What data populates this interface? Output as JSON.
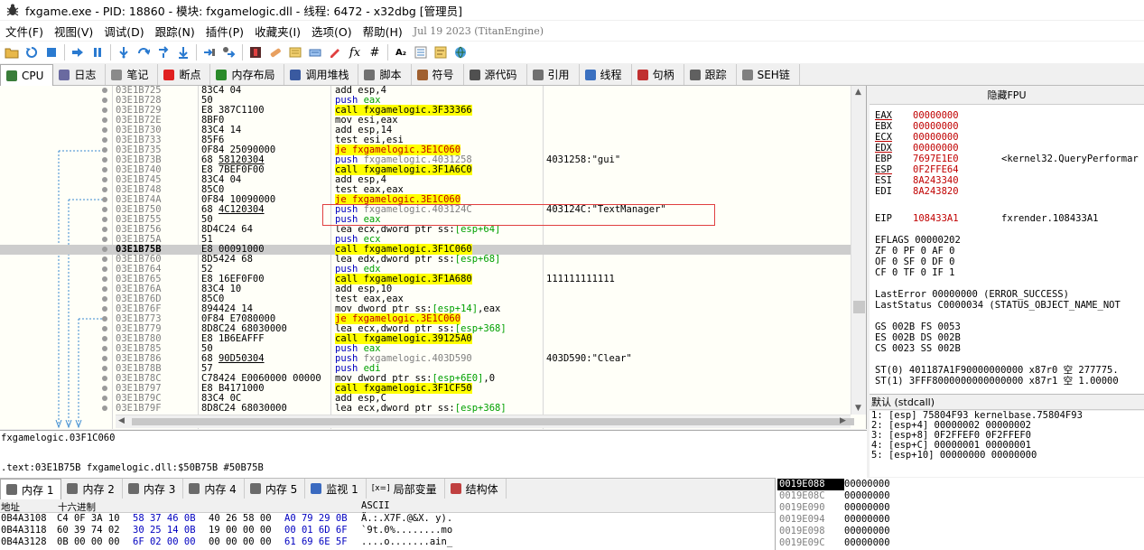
{
  "window": {
    "title": "fxgame.exe - PID: 18860 - 模块: fxgamelogic.dll - 线程: 6472 - x32dbg [管理员]"
  },
  "menu": {
    "items": [
      "文件(F)",
      "视图(V)",
      "调试(D)",
      "跟踪(N)",
      "插件(P)",
      "收藏夹(I)",
      "选项(O)",
      "帮助(H)"
    ],
    "version": "Jul 19 2023 (TitanEngine)"
  },
  "toolbar": {
    "icons": [
      "open-icon",
      "restart-icon",
      "stop-icon",
      "run-icon",
      "pause-icon",
      "step-into-icon",
      "step-over-icon",
      "trace-into-icon",
      "trace-over-icon",
      "execute-till-return-icon",
      "run-to-user-code-icon",
      "scylla-icon",
      "patch-icon",
      "comment-icon",
      "label-icon",
      "bookmark-icon",
      "function-icon",
      "hash-icon",
      "font-icon",
      "list-icon",
      "script-icon",
      "globe-icon"
    ],
    "glyphs": {
      "function-icon": "fx",
      "hash-icon": "#",
      "font-icon": "A₂"
    }
  },
  "tabs": [
    {
      "label": "CPU",
      "icon": "cpu-icon",
      "color": "#3a7d3a"
    },
    {
      "label": "日志",
      "icon": "log-icon",
      "color": "#6a6aa0"
    },
    {
      "label": "笔记",
      "icon": "notes-icon",
      "color": "#8a8a8a"
    },
    {
      "label": "断点",
      "icon": "breakpoint-icon",
      "color": "#e02020"
    },
    {
      "label": "内存布局",
      "icon": "memory-map-icon",
      "color": "#2a8a2a"
    },
    {
      "label": "调用堆栈",
      "icon": "call-stack-icon",
      "color": "#3a5aa0"
    },
    {
      "label": "脚本",
      "icon": "script-icon",
      "color": "#707070"
    },
    {
      "label": "符号",
      "icon": "symbols-icon",
      "color": "#a06030"
    },
    {
      "label": "源代码",
      "icon": "source-icon",
      "color": "#505050"
    },
    {
      "label": "引用",
      "icon": "references-icon",
      "color": "#707070"
    },
    {
      "label": "线程",
      "icon": "threads-icon",
      "color": "#3a70c0"
    },
    {
      "label": "句柄",
      "icon": "handles-icon",
      "color": "#c03030"
    },
    {
      "label": "跟踪",
      "icon": "trace-icon",
      "color": "#606060"
    },
    {
      "label": "SEH链",
      "icon": "seh-icon",
      "color": "#808080"
    }
  ],
  "disasm": {
    "rows": [
      {
        "addr": "03E1B725",
        "bytes": "83C4 04",
        "asm": [
          [
            "t",
            "add esp,4"
          ]
        ],
        "cmt": ""
      },
      {
        "addr": "03E1B728",
        "bytes": "50",
        "asm": [
          [
            "p",
            "push "
          ],
          [
            "r",
            "eax"
          ]
        ],
        "cmt": ""
      },
      {
        "addr": "03E1B729",
        "bytes": "E8 387C1100",
        "asm": [
          [
            "c",
            "call fxgamelogic.3F33366"
          ]
        ],
        "cmt": ""
      },
      {
        "addr": "03E1B72E",
        "bytes": "8BF0",
        "asm": [
          [
            "t",
            "mov esi,eax"
          ]
        ],
        "cmt": ""
      },
      {
        "addr": "03E1B730",
        "bytes": "83C4 14",
        "asm": [
          [
            "t",
            "add esp,14"
          ]
        ],
        "cmt": ""
      },
      {
        "addr": "03E1B733",
        "bytes": "85F6",
        "asm": [
          [
            "t",
            "test esi,esi"
          ]
        ],
        "cmt": ""
      },
      {
        "addr": "03E1B735",
        "bytes": "0F84 25090000",
        "asm": [
          [
            "j",
            "je fxgamelogic.3E1C060"
          ]
        ],
        "cmt": ""
      },
      {
        "addr": "03E1B73B",
        "bytes": "68 58120304",
        "bu": "58120304",
        "asm": [
          [
            "p",
            "push "
          ],
          [
            "f",
            "fxgamelogic.4031258"
          ]
        ],
        "cmt": "4031258:\"gui\""
      },
      {
        "addr": "03E1B740",
        "bytes": "E8 7BEF0F00",
        "asm": [
          [
            "c",
            "call fxgamelogic.3F1A6C0"
          ]
        ],
        "cmt": ""
      },
      {
        "addr": "03E1B745",
        "bytes": "83C4 04",
        "asm": [
          [
            "t",
            "add esp,4"
          ]
        ],
        "cmt": ""
      },
      {
        "addr": "03E1B748",
        "bytes": "85C0",
        "asm": [
          [
            "t",
            "test eax,eax"
          ]
        ],
        "cmt": ""
      },
      {
        "addr": "03E1B74A",
        "bytes": "0F84 10090000",
        "asm": [
          [
            "j",
            "je fxgamelogic.3E1C060"
          ]
        ],
        "cmt": ""
      },
      {
        "addr": "03E1B750",
        "bytes": "68 4C120304",
        "bu": "4C120304",
        "asm": [
          [
            "p",
            "push "
          ],
          [
            "f",
            "fxgamelogic.403124C"
          ]
        ],
        "cmt": "403124C:\"TextManager\""
      },
      {
        "addr": "03E1B755",
        "bytes": "50",
        "asm": [
          [
            "p",
            "push "
          ],
          [
            "r",
            "eax"
          ]
        ],
        "cmt": ""
      },
      {
        "addr": "03E1B756",
        "bytes": "8D4C24 64",
        "asm": [
          [
            "t",
            "lea ecx,dword ptr ss:"
          ],
          [
            "r",
            "[esp+64]"
          ]
        ],
        "cmt": ""
      },
      {
        "addr": "03E1B75A",
        "bytes": "51",
        "asm": [
          [
            "p",
            "push "
          ],
          [
            "r",
            "ecx"
          ]
        ],
        "cmt": ""
      },
      {
        "addr": "03E1B75B",
        "bytes": "E8 00091000",
        "asm": [
          [
            "c",
            "call fxgamelogic.3F1C060"
          ]
        ],
        "cmt": "",
        "hl": true
      },
      {
        "addr": "03E1B760",
        "bytes": "8D5424 68",
        "asm": [
          [
            "t",
            "lea edx,dword ptr ss:"
          ],
          [
            "r",
            "[esp+68]"
          ]
        ],
        "cmt": ""
      },
      {
        "addr": "03E1B764",
        "bytes": "52",
        "asm": [
          [
            "p",
            "push "
          ],
          [
            "r",
            "edx"
          ]
        ],
        "cmt": ""
      },
      {
        "addr": "03E1B765",
        "bytes": "E8 16EF0F00",
        "asm": [
          [
            "c",
            "call fxgamelogic.3F1A680"
          ]
        ],
        "cmt": "111111111111"
      },
      {
        "addr": "03E1B76A",
        "bytes": "83C4 10",
        "asm": [
          [
            "t",
            "add esp,10"
          ]
        ],
        "cmt": ""
      },
      {
        "addr": "03E1B76D",
        "bytes": "85C0",
        "asm": [
          [
            "t",
            "test eax,eax"
          ]
        ],
        "cmt": ""
      },
      {
        "addr": "03E1B76F",
        "bytes": "894424 14",
        "asm": [
          [
            "t",
            "mov dword ptr ss:"
          ],
          [
            "r",
            "[esp+14]"
          ],
          [
            "t",
            ",eax"
          ]
        ],
        "cmt": ""
      },
      {
        "addr": "03E1B773",
        "bytes": "0F84 E7080000",
        "asm": [
          [
            "j",
            "je fxgamelogic.3E1C060"
          ]
        ],
        "cmt": ""
      },
      {
        "addr": "03E1B779",
        "bytes": "8D8C24 68030000",
        "asm": [
          [
            "t",
            "lea ecx,dword ptr ss:"
          ],
          [
            "r",
            "[esp+368]"
          ]
        ],
        "cmt": ""
      },
      {
        "addr": "03E1B780",
        "bytes": "E8 1B6EAFFF",
        "asm": [
          [
            "c",
            "call fxgamelogic.39125A0"
          ]
        ],
        "cmt": ""
      },
      {
        "addr": "03E1B785",
        "bytes": "50",
        "asm": [
          [
            "p",
            "push "
          ],
          [
            "r",
            "eax"
          ]
        ],
        "cmt": ""
      },
      {
        "addr": "03E1B786",
        "bytes": "68 90D50304",
        "bu": "90D50304",
        "asm": [
          [
            "p",
            "push "
          ],
          [
            "f",
            "fxgamelogic.403D590"
          ]
        ],
        "cmt": "403D590:\"Clear\""
      },
      {
        "addr": "03E1B78B",
        "bytes": "57",
        "asm": [
          [
            "p",
            "push "
          ],
          [
            "r",
            "edi"
          ]
        ],
        "cmt": ""
      },
      {
        "addr": "03E1B78C",
        "bytes": "C78424 E0060000 00000",
        "asm": [
          [
            "t",
            "mov dword ptr ss:"
          ],
          [
            "r",
            "[esp+6E0]"
          ],
          [
            "t",
            ",0"
          ]
        ],
        "cmt": ""
      },
      {
        "addr": "03E1B797",
        "bytes": "E8 B4171000",
        "asm": [
          [
            "c",
            "call fxgamelogic.3F1CF50"
          ]
        ],
        "cmt": ""
      },
      {
        "addr": "03E1B79C",
        "bytes": "83C4 0C",
        "asm": [
          [
            "t",
            "add esp,C"
          ]
        ],
        "cmt": ""
      },
      {
        "addr": "03E1B79F",
        "bytes": "8D8C24 68030000",
        "asm": [
          [
            "t",
            "lea ecx,dword ptr ss:"
          ],
          [
            "r",
            "[esp+368]"
          ]
        ],
        "cmt": ""
      }
    ]
  },
  "info": {
    "line1": "fxgamelogic.03F1C060",
    "line2": ".text:03E1B75B fxgamelogic.dll:$50B75B #50B75B"
  },
  "registers": {
    "header": "隐藏FPU",
    "gpr": [
      {
        "n": "EAX",
        "v": "00000000",
        "c": "",
        "u": true
      },
      {
        "n": "EBX",
        "v": "00000000",
        "c": ""
      },
      {
        "n": "ECX",
        "v": "00000000",
        "c": "",
        "u": true
      },
      {
        "n": "EDX",
        "v": "00000000",
        "c": "",
        "u": true
      },
      {
        "n": "EBP",
        "v": "7697E1E0",
        "c": "<kernel32.QueryPerformar"
      },
      {
        "n": "ESP",
        "v": "0F2FFE64",
        "c": "",
        "u": true
      },
      {
        "n": "ESI",
        "v": "8A243340",
        "c": ""
      },
      {
        "n": "EDI",
        "v": "8A243820",
        "c": ""
      }
    ],
    "eip": {
      "n": "EIP",
      "v": "108433A1",
      "c": "fxrender.108433A1"
    },
    "eflags": "EFLAGS   00000202",
    "flags1": "ZF 0  PF 0  AF 0",
    "flags2": "OF 0  SF 0  DF 0",
    "flags3": "CF 0  TF 0  IF 1",
    "lasterror": "LastError  00000000 (ERROR_SUCCESS)",
    "laststatus": "LastStatus C0000034 (STATUS_OBJECT_NAME_NOT",
    "seg1": "GS 002B  FS 0053",
    "seg2": "ES 002B  DS 002B",
    "seg3": "CS 0023  SS 002B",
    "st0": "ST(0) 401187A1F90000000000 x87r0 空 277775.",
    "st1": "ST(1) 3FFF8000000000000000 x87r1 空 1.00000"
  },
  "callconv": {
    "label": "默认 (stdcall)"
  },
  "args": [
    "1: [esp] 75804F93 kernelbase.75804F93",
    "2: [esp+4] 00000002 00000002",
    "3: [esp+8] 0F2FFEF0 0F2FFEF0",
    "4: [esp+C] 00000001 00000001",
    "5: [esp+10] 00000000 00000000"
  ],
  "bottom_tabs": [
    {
      "label": "内存 1",
      "icon": "memory-1-icon"
    },
    {
      "label": "内存 2",
      "icon": "memory-2-icon"
    },
    {
      "label": "内存 3",
      "icon": "memory-3-icon"
    },
    {
      "label": "内存 4",
      "icon": "memory-4-icon"
    },
    {
      "label": "内存 5",
      "icon": "memory-5-icon"
    },
    {
      "label": "监视 1",
      "icon": "watch-icon"
    },
    {
      "label": "局部变量",
      "icon": "locals-icon",
      "glyph": "[x=]"
    },
    {
      "label": "结构体",
      "icon": "struct-icon"
    }
  ],
  "dump": {
    "headers": {
      "addr": "地址",
      "hex": "十六进制",
      "ascii": "ASCII"
    },
    "rows": [
      {
        "addr": "0B4A3108",
        "hex": [
          "C4 0F 3A 10",
          "58 37 46 0B",
          "40 26 58 00",
          "A0 79 29 0B"
        ],
        "ascii": "Ä.:.X7F.@&X. y)."
      },
      {
        "addr": "0B4A3118",
        "hex": [
          "60 39 74 02",
          "30 25 14 0B",
          "19 00 00 00",
          "00 01 6D 6F"
        ],
        "ascii": "`9t.0%........mo"
      },
      {
        "addr": "0B4A3128",
        "hex": [
          "0B 00 00 00",
          "6F 02 00 00",
          "00 00 00 00",
          "61 69 6E 5F"
        ],
        "ascii": "....o.......ain_"
      }
    ]
  },
  "stack": [
    {
      "a": "0019E088",
      "v": "00000000",
      "top": true
    },
    {
      "a": "0019E08C",
      "v": "00000000"
    },
    {
      "a": "0019E090",
      "v": "00000000"
    },
    {
      "a": "0019E094",
      "v": "00000000"
    },
    {
      "a": "0019E098",
      "v": "00000000"
    },
    {
      "a": "0019E09C",
      "v": "00000000"
    }
  ],
  "colors": {
    "call_bg": "#ffff00",
    "jump_fg": "#c00000",
    "push_fg": "#0000c0",
    "reg_fg": "#00a000",
    "highlight_row": "#cdcdcd",
    "register_value": "#c00000"
  }
}
